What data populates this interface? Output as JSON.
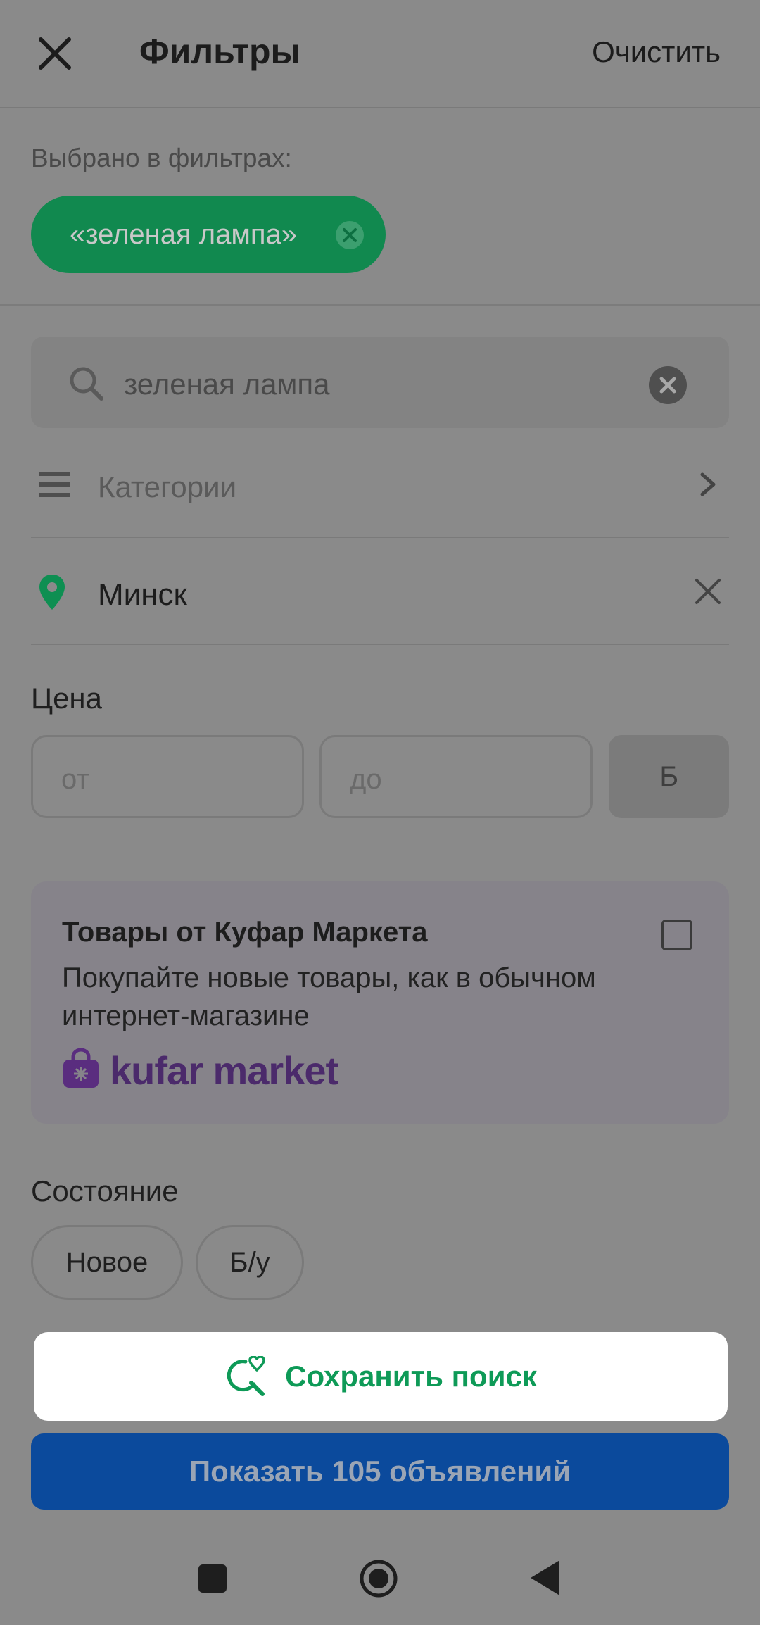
{
  "header": {
    "title": "Фильтры",
    "clear_label": "Очистить"
  },
  "selected": {
    "label": "Выбрано в фильтрах:",
    "chip_text": "«зеленая лампа»"
  },
  "search": {
    "value": "зеленая лампа"
  },
  "category": {
    "label": "Категории"
  },
  "location": {
    "label": "Минск"
  },
  "price": {
    "label": "Цена",
    "from_placeholder": "от",
    "to_placeholder": "до",
    "currency": "Ƃ"
  },
  "market": {
    "title": "Товары от Куфар Маркета",
    "description": "Покупайте новые товары, как в обычном интернет-магазине",
    "logo_text": "kufar market"
  },
  "condition": {
    "label": "Состояние",
    "options": [
      "Новое",
      "Б/у"
    ]
  },
  "actions": {
    "save_search": "Сохранить поиск",
    "show_results": "Показать 105 объявлений"
  },
  "colors": {
    "accent_green": "#0e9a57",
    "primary_blue": "#0b4a9c",
    "market_purple": "#4b2a6b"
  },
  "icons": {
    "close": "close-icon",
    "chip_remove": "clear-circle-icon",
    "search": "search-icon",
    "search_clear": "clear-circle-icon",
    "category": "hamburger-icon",
    "category_chevron": "chevron-right-icon",
    "location": "map-pin-icon",
    "location_clear": "close-icon",
    "market_bag": "shopping-bag-icon",
    "save_search": "heart-search-icon",
    "nav_recent": "square-icon",
    "nav_home": "home-circle-icon",
    "nav_back": "back-triangle-icon"
  }
}
